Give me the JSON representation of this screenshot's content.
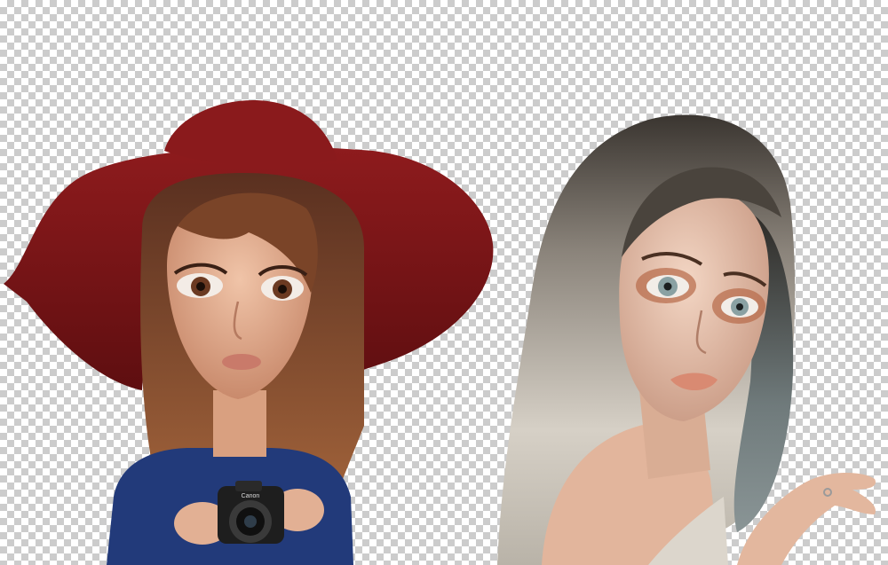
{
  "canvas": {
    "background": "transparency-checkerboard",
    "checker_colors": [
      "#ffffff",
      "#cccccc"
    ]
  },
  "figures": [
    {
      "name": "left-figure",
      "hat_color": "#7a1416",
      "hair_color": "#6b3a22",
      "sweater_color": "#223a7a",
      "camera_label": "Canon"
    },
    {
      "name": "right-figure",
      "hair_color": "#c8c2b6",
      "hair_root_color": "#3a3530",
      "eye_color": "#8aa1a3",
      "top_color": "#dcd6cc"
    }
  ]
}
